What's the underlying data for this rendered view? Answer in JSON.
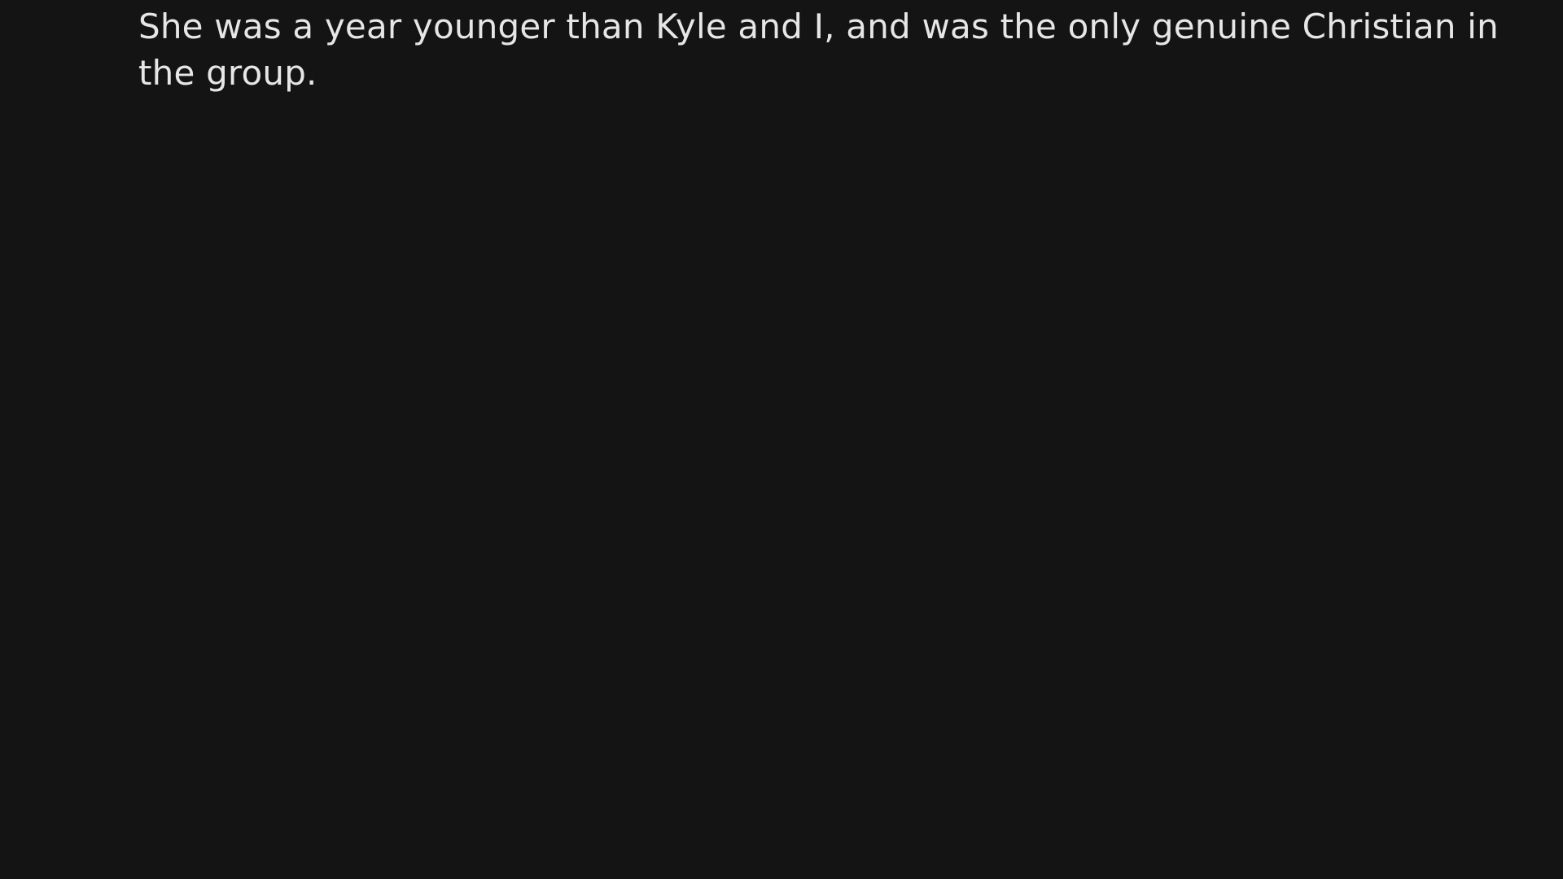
{
  "reader": {
    "paragraph": "She was a year younger than Kyle and I, and was the only genuine Christian in the group."
  },
  "colors": {
    "background": "#141414",
    "text": "#e6e6e6"
  }
}
